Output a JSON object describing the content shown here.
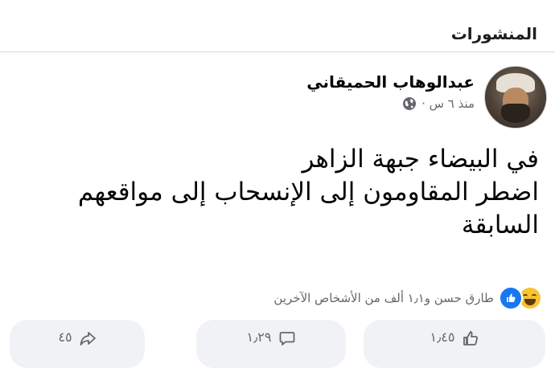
{
  "section": {
    "title": "المنشورات"
  },
  "post": {
    "author": "عبدالوهاب الحميقاني",
    "timestamp": "منذ ٦ س ·",
    "privacy_icon": "globe-icon",
    "lines": [
      "في البيضاء جبهة الزاهر",
      "اضطر المقاومون إلى الإنسحاب إلى مواقعهم",
      "السابقة"
    ]
  },
  "reactions": {
    "icons": [
      "like-icon",
      "haha-icon"
    ],
    "summary": "طارق حسن و١٫١ ألف من الأشخاص الآخرين"
  },
  "actions": {
    "like_count": "١٫٤٥",
    "comment_count": "١٫٢٩",
    "share_count": "٤٥"
  },
  "colors": {
    "text_primary": "#050505",
    "text_secondary": "#65676b",
    "like_blue": "#1877f2",
    "haha_yellow": "#f7c331",
    "button_bg": "#f0f2f5"
  }
}
